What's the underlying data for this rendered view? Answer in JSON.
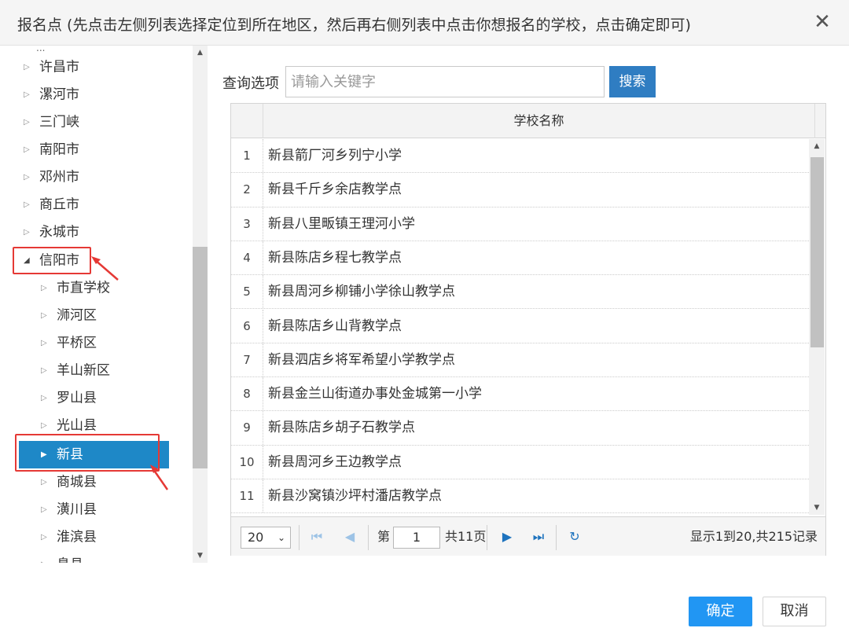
{
  "dialog": {
    "title": "报名点 (先点击左侧列表选择定位到所在地区，然后再右侧列表中点击你想报名的学校，点击确定即可)",
    "close_glyph": "✕"
  },
  "tree": {
    "cut_top": "...",
    "items": [
      {
        "label": "许昌市",
        "expanded": false
      },
      {
        "label": "漯河市",
        "expanded": false
      },
      {
        "label": "三门峡",
        "expanded": false
      },
      {
        "label": "南阳市",
        "expanded": false
      },
      {
        "label": "邓州市",
        "expanded": false
      },
      {
        "label": "商丘市",
        "expanded": false
      },
      {
        "label": "永城市",
        "expanded": false
      },
      {
        "label": "信阳市",
        "expanded": true
      },
      {
        "label": "市直学校",
        "expanded": false
      },
      {
        "label": "浉河区",
        "expanded": false
      },
      {
        "label": "平桥区",
        "expanded": false
      },
      {
        "label": "羊山新区",
        "expanded": false
      },
      {
        "label": "罗山县",
        "expanded": false
      },
      {
        "label": "光山县",
        "expanded": false
      },
      {
        "label": "新县",
        "expanded": false,
        "selected": true
      },
      {
        "label": "商城县",
        "expanded": false
      },
      {
        "label": "潢川县",
        "expanded": false
      },
      {
        "label": "淮滨县",
        "expanded": false
      },
      {
        "label": "息县",
        "expanded": false
      }
    ]
  },
  "search": {
    "label": "查询选项",
    "placeholder": "请输入关键字",
    "button": "搜索"
  },
  "grid": {
    "column_header": "学校名称",
    "rows": [
      {
        "num": "1",
        "name": "新县箭厂河乡列宁小学"
      },
      {
        "num": "2",
        "name": "新县千斤乡余店教学点"
      },
      {
        "num": "3",
        "name": "新县八里畈镇王理河小学"
      },
      {
        "num": "4",
        "name": "新县陈店乡程七教学点"
      },
      {
        "num": "5",
        "name": "新县周河乡柳铺小学徐山教学点"
      },
      {
        "num": "6",
        "name": "新县陈店乡山背教学点"
      },
      {
        "num": "7",
        "name": "新县泗店乡将军希望小学教学点"
      },
      {
        "num": "8",
        "name": "新县金兰山街道办事处金城第一小学"
      },
      {
        "num": "9",
        "name": "新县陈店乡胡子石教学点"
      },
      {
        "num": "10",
        "name": "新县周河乡王边教学点"
      },
      {
        "num": "11",
        "name": "新县沙窝镇沙坪村潘店教学点"
      }
    ]
  },
  "pager": {
    "page_size": "20",
    "page_prefix": "第",
    "current_page": "1",
    "total_pages": "共11页",
    "records": "显示1到20,共215记录"
  },
  "footer": {
    "ok": "确定",
    "cancel": "取消"
  },
  "colors": {
    "selected": "#1e88c7",
    "primary_button": "#2196f3",
    "annotation": "#e53935"
  }
}
